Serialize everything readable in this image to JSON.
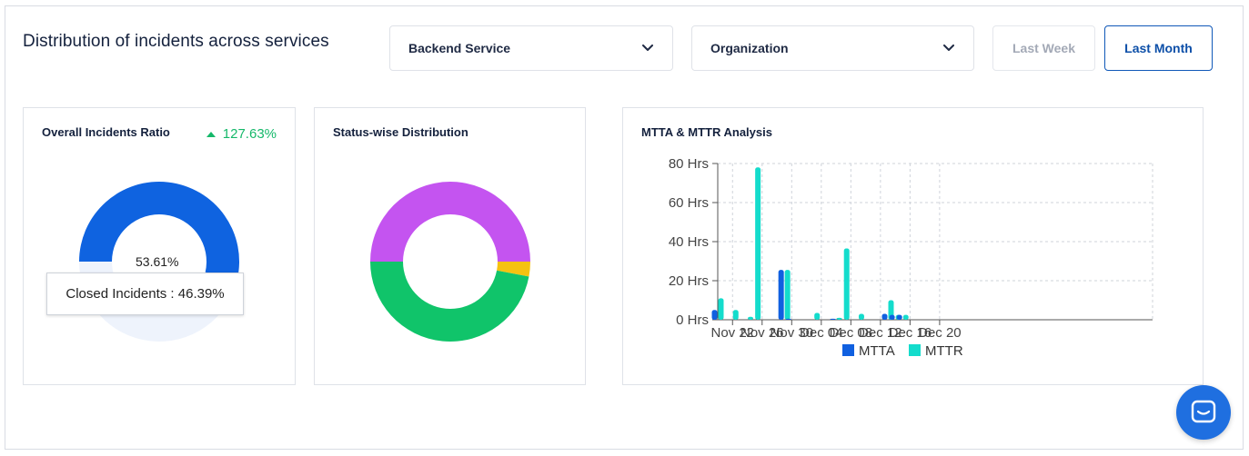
{
  "page": {
    "title": "Distribution of incidents across services"
  },
  "filters": {
    "service_label": "Backend Service",
    "org_label": "Organization",
    "last_week_label": "Last Week",
    "last_month_label": "Last Month"
  },
  "cards": {
    "overall": {
      "title": "Overall Incidents Ratio",
      "delta": "127.63%",
      "center_label": "53.61%",
      "tooltip": "Closed Incidents : 46.39%",
      "donut": {
        "open_percent": 53.61,
        "closed_percent": 46.39
      }
    },
    "status": {
      "title": "Status-wise Distribution"
    },
    "mtta": {
      "title": "MTTA & MTTR Analysis"
    }
  },
  "colors": {
    "mtta": "#1060e0",
    "mttr": "#14dccc",
    "ratio_main": "#0f63e0",
    "ratio_light": "#eef3fc",
    "status_purple": "#c454f0",
    "status_yellow": "#f5c211",
    "status_green": "#10c46a",
    "accent": "#0d4fa8",
    "positive": "#15b86a"
  },
  "icons": {
    "chevron": "chevron-down-icon",
    "delta": "triangle-up-icon",
    "chat": "chat-bubble-icon"
  },
  "chart_data": [
    {
      "type": "pie",
      "title": "Overall Incidents Ratio",
      "slices": [
        {
          "label": "",
          "value": 53.61
        },
        {
          "label": "Closed Incidents",
          "value": 46.39
        }
      ]
    },
    {
      "type": "pie",
      "title": "Status-wise Distribution",
      "slices": [
        {
          "label": "",
          "value": 50
        },
        {
          "label": "",
          "value": 3
        },
        {
          "label": "",
          "value": 47
        }
      ]
    },
    {
      "type": "bar",
      "title": "MTTA & MTTR Analysis",
      "y_unit": "Hrs",
      "ylim": [
        0,
        80
      ],
      "y_ticks": [
        "0 Hrs",
        "20 Hrs",
        "40 Hrs",
        "60 Hrs",
        "80 Hrs"
      ],
      "y_tick_values": [
        0,
        20,
        40,
        60,
        80
      ],
      "x_ticks": [
        "Nov 22",
        "Nov 26",
        "Nov 30",
        "Dec 04",
        "Dec 08",
        "Dec 12",
        "Dec 16",
        "Dec 20"
      ],
      "grid": true,
      "legend": "bottom",
      "categories": [
        "Nov 20",
        "Nov 22",
        "Nov 24",
        "Nov 25",
        "Nov 29",
        "Nov 30",
        "Dec 03",
        "Dec 06",
        "Dec 07",
        "Dec 09",
        "Dec 13",
        "Dec 14",
        "Dec 15"
      ],
      "series": [
        {
          "name": "MTTA",
          "values": [
            5,
            0,
            0,
            0,
            25.5,
            0.5,
            0,
            0.5,
            0,
            0,
            3,
            2.5,
            2.5
          ]
        },
        {
          "name": "MTTR",
          "values": [
            11,
            5,
            1.5,
            78,
            25.5,
            0,
            3.5,
            1,
            36.5,
            3,
            10,
            2.5,
            2.5
          ]
        }
      ]
    }
  ]
}
